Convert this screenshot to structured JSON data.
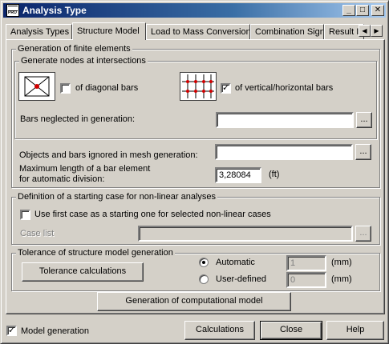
{
  "window": {
    "title": "Analysis Type",
    "app_icon_text": "PRO"
  },
  "tabs": [
    {
      "label": "Analysis Types"
    },
    {
      "label": "Structure Model"
    },
    {
      "label": "Load to Mass Conversion"
    },
    {
      "label": "Combination Sign"
    },
    {
      "label": "Result I"
    }
  ],
  "generation": {
    "legend": "Generation of finite elements",
    "nodes_legend": "Generate nodes at intersections",
    "diagonal_label": "of diagonal bars",
    "diagonal_checked": false,
    "vh_label": "of vertical/horizontal bars",
    "vh_checked": true,
    "bars_neglected_label": "Bars neglected in generation:",
    "bars_neglected_value": "",
    "objects_ignored_label": "Objects and bars ignored in mesh generation:",
    "objects_ignored_value": "",
    "maxlen_label_1": "Maximum length of a bar element",
    "maxlen_label_2": "for automatic division:",
    "maxlen_value": "3,28084",
    "maxlen_unit": "(ft)"
  },
  "nonlinear": {
    "legend": "Definition of a starting case for non-linear analyses",
    "use_first_label": "Use first case as a starting one for selected non-linear cases",
    "use_first_checked": false,
    "case_list_label": "Case list",
    "case_list_value": ""
  },
  "tolerance": {
    "legend": "Tolerance of structure model generation",
    "calc_button": "Tolerance calculations",
    "automatic_label": "Automatic",
    "automatic_value": "1",
    "user_label": "User-defined",
    "user_value": "0",
    "unit": "(mm)",
    "selected": "Automatic"
  },
  "generate_button": "Generation of computational model",
  "footer": {
    "model_generation_label": "Model generation",
    "model_generation_checked": true,
    "calculations": "Calculations",
    "close": "Close",
    "help": "Help"
  },
  "ellipsis": "...",
  "titlebar_buttons": {
    "minimize": "_",
    "maximize": "□",
    "close": "✕"
  },
  "tab_scroll": {
    "left": "◀",
    "right": "▶"
  },
  "checkmark": "✓"
}
